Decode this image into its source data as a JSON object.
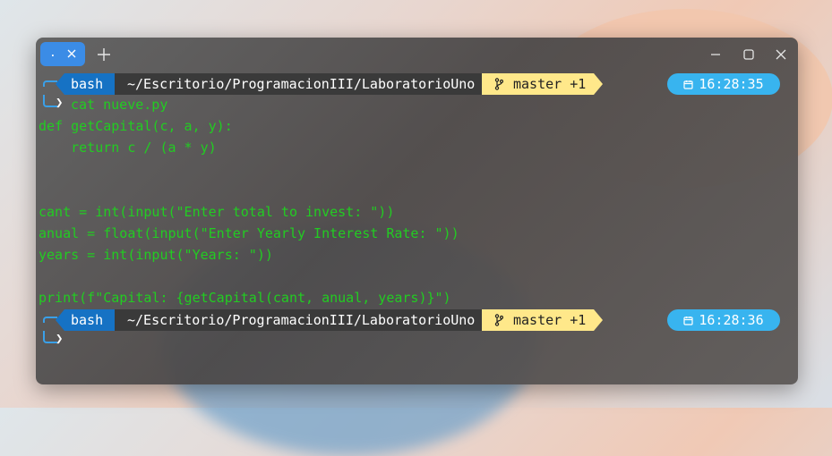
{
  "tab": {
    "title": "."
  },
  "prompts": [
    {
      "shell": "bash",
      "path": "~/Escritorio/ProgramacionIII/LaboratorioUno",
      "git": "master +1",
      "time": "16:28:35",
      "command": "cat nueve.py"
    },
    {
      "shell": "bash",
      "path": "~/Escritorio/ProgramacionIII/LaboratorioUno",
      "git": "master +1",
      "time": "16:28:36",
      "command": ""
    }
  ],
  "output": [
    "def getCapital(c, a, y):",
    "    return c / (a * y)",
    "",
    "",
    "cant = int(input(\"Enter total to invest: \"))",
    "anual = float(input(\"Enter Yearly Interest Rate: \"))",
    "years = int(input(\"Years: \"))",
    "",
    "print(f\"Capital: {getCapital(cant, anual, years)}\")"
  ],
  "colors": {
    "tab_bg": "#3b8ce6",
    "bash_seg": "#1672c4",
    "path_seg": "#3a3a3a",
    "git_seg": "#ffe88a",
    "clock_bg": "#38b4ef",
    "code_text": "#22cc22"
  },
  "icons": {
    "branch": "git-branch-icon",
    "calendar": "calendar-icon",
    "chevron": "prompt-chevron-icon"
  }
}
